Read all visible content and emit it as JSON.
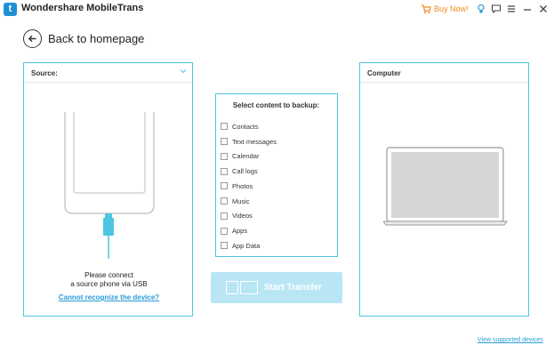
{
  "titlebar": {
    "logo_letter": "t",
    "title": "Wondershare MobileTrans",
    "buy_now": "Buy Now!",
    "icons": [
      "cart-icon",
      "lightbulb-icon",
      "feedback-icon",
      "menu-icon",
      "minimize-icon",
      "close-icon"
    ]
  },
  "nav": {
    "back_label": "Back to homepage"
  },
  "source": {
    "header": "Source:",
    "connect_line1": "Please connect",
    "connect_line2": "a source phone via USB",
    "cannot_link": "Cannot recognize the device?"
  },
  "computer": {
    "header": "Computer"
  },
  "select": {
    "title": "Select content to backup:",
    "items": [
      {
        "label": "Contacts",
        "checked": false
      },
      {
        "label": "Text messages",
        "checked": false
      },
      {
        "label": "Calendar",
        "checked": false
      },
      {
        "label": "Call logs",
        "checked": false
      },
      {
        "label": "Photos",
        "checked": false
      },
      {
        "label": "Music",
        "checked": false
      },
      {
        "label": "Videos",
        "checked": false
      },
      {
        "label": "Apps",
        "checked": false
      },
      {
        "label": "App Data",
        "checked": false
      }
    ]
  },
  "actions": {
    "start_transfer": "Start Transfer",
    "view_devices": "View supported devices"
  },
  "colors": {
    "accent": "#4cc6e0",
    "link": "#2a9bd6",
    "button_disabled": "#b9e6f5",
    "buy_now": "#f08a1c"
  }
}
